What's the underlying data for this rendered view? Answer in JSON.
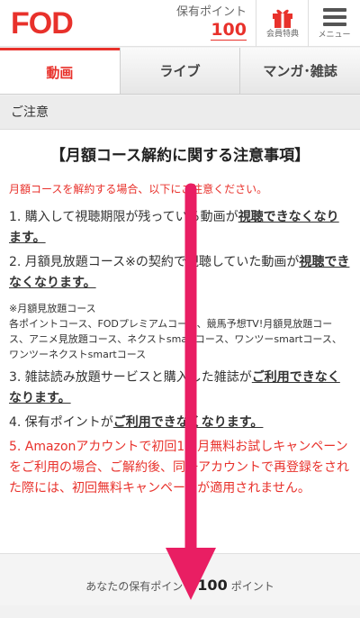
{
  "header": {
    "logo": "FOD",
    "points_label": "保有ポイント",
    "points_value": "100",
    "member_label": "会員特典",
    "menu_label": "メニュー"
  },
  "tabs": [
    {
      "label": "動画",
      "active": true
    },
    {
      "label": "ライブ",
      "active": false
    },
    {
      "label": "マンガ･雑誌",
      "active": false
    }
  ],
  "section_title": "ご注意",
  "content": {
    "heading": "【月額コース解約に関する注意事項】",
    "intro": "月額コースを解約する場合、以下にご注意ください。",
    "item1_text": "1. 購入して視聴期限が残っている動画が",
    "item1_emph": "視聴できなくなります。",
    "item2_text": "2. 月額見放題コース※の契約で視聴していた動画が",
    "item2_emph": "視聴できなくなります。",
    "note_title": "※月額見放題コース",
    "note_body": "各ポイントコース、FODプレミアムコース、競馬予想TV!月額見放題コース、アニメ見放題コース、ネクストsmartコース、ワンツーsmartコース、ワンツーネクストsmartコース",
    "item3_text": "3. 雑誌読み放題サービスと購入した雑誌が",
    "item3_emph": "ご利用できなくなります。",
    "item4_text": "4. 保有ポイントが",
    "item4_emph": "ご利用できなくなります。",
    "item5_text": "5. Amazonアカウントで初回1ヵ月無料お試しキャンペーンをご利用の場合、ご解約後、同一アカウントで再登録をされた際には、初回無料キャンペーンが適用されません。"
  },
  "bottom": {
    "prefix": "あなたの保有ポイント",
    "value": "100",
    "suffix": "ポイント"
  },
  "colors": {
    "accent": "#e8312b",
    "arrow": "#e91e63"
  }
}
